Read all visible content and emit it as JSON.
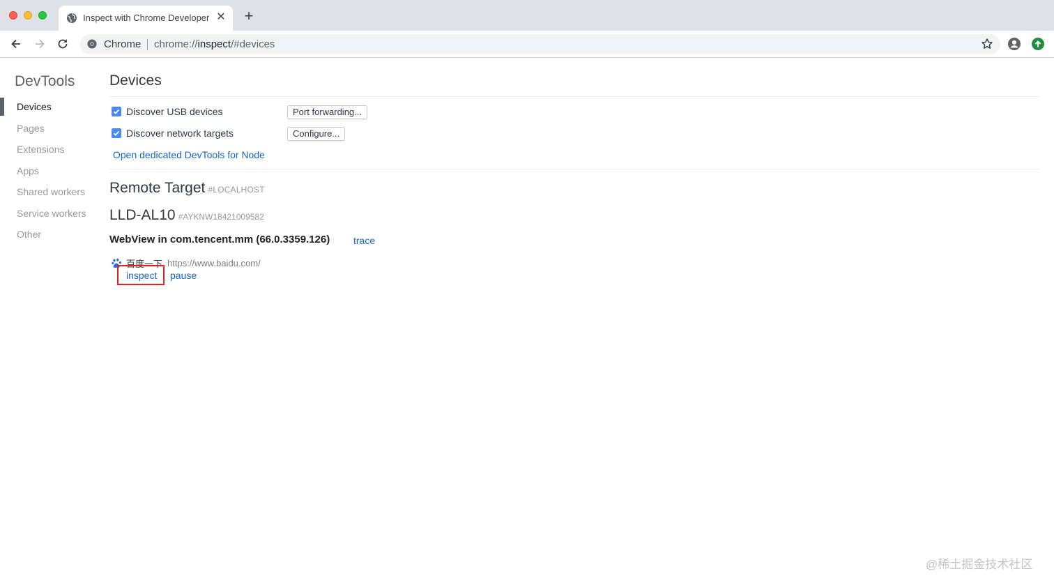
{
  "window": {
    "tab_title": "Inspect with Chrome Developer Tools",
    "tab_close": "✕",
    "new_tab": "+"
  },
  "toolbar": {
    "site_name": "Chrome",
    "url_scheme": "chrome://",
    "url_host": "inspect",
    "url_path": "/#devices"
  },
  "sidebar": {
    "title": "DevTools",
    "items": [
      {
        "label": "Devices",
        "selected": true
      },
      {
        "label": "Pages",
        "selected": false
      },
      {
        "label": "Extensions",
        "selected": false
      },
      {
        "label": "Apps",
        "selected": false
      },
      {
        "label": "Shared workers",
        "selected": false
      },
      {
        "label": "Service workers",
        "selected": false
      },
      {
        "label": "Other",
        "selected": false
      }
    ]
  },
  "main": {
    "title": "Devices",
    "options": [
      {
        "label": "Discover USB devices",
        "checked": true,
        "button": "Port forwarding..."
      },
      {
        "label": "Discover network targets",
        "checked": true,
        "button": "Configure..."
      }
    ],
    "node_link": "Open dedicated DevTools for Node",
    "remote_target": {
      "title": "Remote Target",
      "subtitle": "#LOCALHOST"
    },
    "device": {
      "name": "LLD-AL10",
      "serial": "#AYKNW18421009582",
      "browser": "WebView in com.tencent.mm (66.0.3359.126)",
      "trace": "trace",
      "target": {
        "name": "百度一下",
        "url": "https://www.baidu.com/",
        "inspect": "inspect",
        "pause": "pause"
      }
    }
  },
  "watermark": "@稀土掘金技术社区",
  "colors": {
    "accent": "#1a64c8",
    "checkbox": "#4a8af4",
    "highlight": "#e02020",
    "tabstrip": "#dee1e6"
  }
}
